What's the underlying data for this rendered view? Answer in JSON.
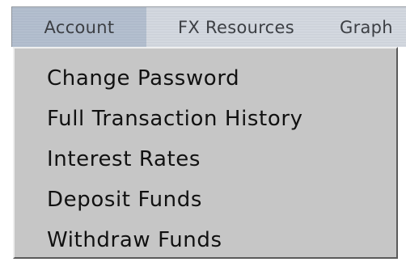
{
  "menubar": {
    "tabs": [
      {
        "label": "Account"
      },
      {
        "label": "FX Resources"
      },
      {
        "label": "Graph"
      }
    ]
  },
  "dropdown": {
    "items": [
      {
        "label": "Change Password"
      },
      {
        "label": "Full Transaction History"
      },
      {
        "label": "Interest Rates"
      },
      {
        "label": "Deposit Funds"
      },
      {
        "label": "Withdraw Funds"
      }
    ]
  },
  "colors": {
    "menubar_bg": "#d8dde4",
    "active_tab_bg": "#b8c3d2",
    "dropdown_bg": "#c6c6c6",
    "menu_text": "#111111"
  }
}
